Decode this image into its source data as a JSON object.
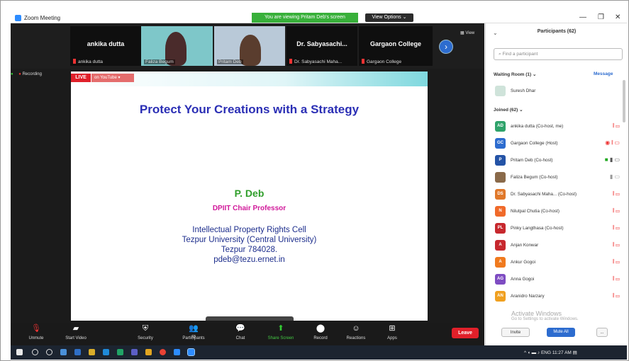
{
  "window": {
    "title": "Zoom Meeting",
    "viewing_banner": "You are viewing Pritam Deb's screen",
    "view_options": "View Options",
    "controls": [
      "—",
      "❐",
      "✕"
    ]
  },
  "video_strip": {
    "tiles": [
      {
        "name": "ankika dutta",
        "label": "ankika dutta"
      },
      {
        "name": "",
        "label": "Faliza Begum"
      },
      {
        "name": "",
        "label": "Pritam Deb"
      },
      {
        "name": "Dr. Sabyasachi...",
        "label": "Dr. Sabyasachi Maha..."
      },
      {
        "name": "Gargaon College",
        "label": "Gargaon College"
      }
    ],
    "view_button": "View"
  },
  "recording": "Recording",
  "stream": {
    "live": "LIVE",
    "platform": "on YouTube"
  },
  "slide": {
    "title": "Protect Your Creations with a Strategy",
    "author": "P. Deb",
    "role": "DPIIT Chair Professor",
    "affiliation": [
      "Intellectual Property Rights Cell",
      "Tezpur University (Central University)",
      "Tezpur 784028.",
      "pdeb@tezu.ernet.in"
    ]
  },
  "toolbar": {
    "buttons": [
      {
        "label": "Unmute",
        "icon": "mic-off-icon"
      },
      {
        "label": "Start Video",
        "icon": "video-off-icon"
      },
      {
        "label": "Security",
        "icon": "shield-icon"
      },
      {
        "label": "Participants",
        "icon": "people-icon",
        "count": "63"
      },
      {
        "label": "Chat",
        "icon": "chat-icon"
      },
      {
        "label": "Share Screen",
        "icon": "share-screen-icon"
      },
      {
        "label": "Record",
        "icon": "record-icon"
      },
      {
        "label": "Reactions",
        "icon": "reactions-icon"
      },
      {
        "label": "Apps",
        "icon": "apps-icon"
      }
    ],
    "leave": "Leave"
  },
  "participants_panel": {
    "title": "Participants (62)",
    "search_placeholder": "Find a participant",
    "waiting_room": {
      "label": "Waiting Room (1)",
      "message": "Message",
      "members": [
        {
          "name": "Suresh Dhar",
          "initials": ""
        }
      ]
    },
    "joined": {
      "label": "Joined (62)",
      "members": [
        {
          "name": "ankika dutta (Co-host, me)",
          "initials": "AD",
          "color": "#2fa36b"
        },
        {
          "name": "Gargaon College (Host)",
          "initials": "GC",
          "color": "#2d6ccf"
        },
        {
          "name": "Pritam Deb (Co-host)",
          "initials": "P",
          "color": "#2453a6"
        },
        {
          "name": "Faliza Begum (Co-host)",
          "initials": "",
          "color": "#8a6a4a"
        },
        {
          "name": "Dr. Sabyasachi Maha... (Co-host)",
          "initials": "DS",
          "color": "#e0782a"
        },
        {
          "name": "Nilutpal Chutia (Co-host)",
          "initials": "N",
          "color": "#f06a2a"
        },
        {
          "name": "Pinky Langthasa (Co-host)",
          "initials": "PL",
          "color": "#c7282e"
        },
        {
          "name": "Anjan Konwar",
          "initials": "A",
          "color": "#c7282e"
        },
        {
          "name": "Ankur Gogoi",
          "initials": "A",
          "color": "#f07a1e"
        },
        {
          "name": "Anna Gogoi",
          "initials": "AG",
          "color": "#7e4cc2"
        },
        {
          "name": "Aranidro Narzary",
          "initials": "AN",
          "color": "#f0a020"
        }
      ]
    },
    "footer": {
      "invite": "Invite",
      "mute_all": "Mute All",
      "more": "..."
    },
    "watermark": [
      "Activate Windows",
      "Go to Settings to activate Windows."
    ]
  },
  "taskbar": {
    "tray": "ENG  11:27 AM"
  }
}
